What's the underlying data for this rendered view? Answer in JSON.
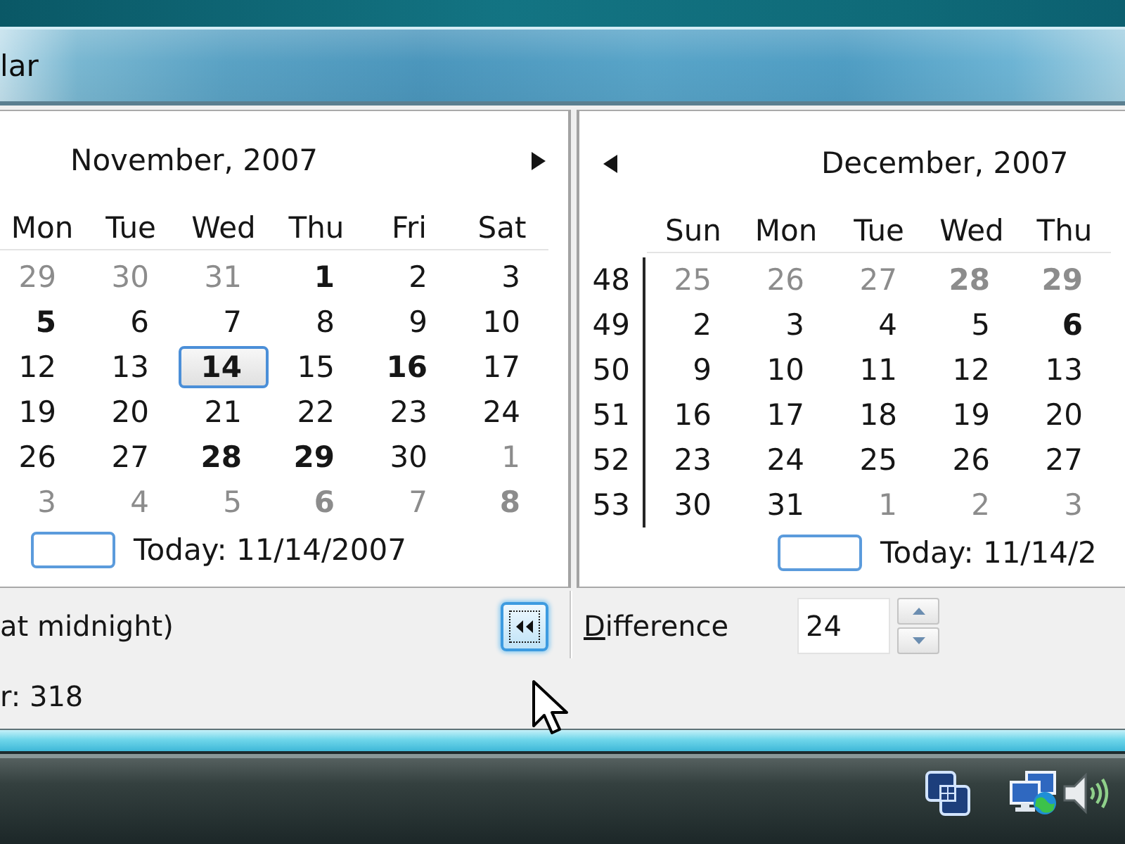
{
  "window": {
    "title": "lar"
  },
  "calendars": [
    {
      "month": "November, 2007",
      "has_prev": false,
      "has_next": true,
      "weekdays": [
        "Mon",
        "Tue",
        "Wed",
        "Thu",
        "Fri",
        "Sat"
      ],
      "weeks": [
        {
          "days": [
            {
              "day": "29",
              "other_month": true,
              "busy": false,
              "selected": false
            },
            {
              "day": "30",
              "other_month": true,
              "busy": false,
              "selected": false
            },
            {
              "day": "31",
              "other_month": true,
              "busy": false,
              "selected": false
            },
            {
              "day": "1",
              "other_month": false,
              "busy": true,
              "selected": false
            },
            {
              "day": "2",
              "other_month": false,
              "busy": false,
              "selected": false
            },
            {
              "day": "3",
              "other_month": false,
              "busy": false,
              "selected": false
            }
          ]
        },
        {
          "days": [
            {
              "day": "5",
              "other_month": false,
              "busy": true,
              "selected": false
            },
            {
              "day": "6",
              "other_month": false,
              "busy": false,
              "selected": false
            },
            {
              "day": "7",
              "other_month": false,
              "busy": false,
              "selected": false
            },
            {
              "day": "8",
              "other_month": false,
              "busy": false,
              "selected": false
            },
            {
              "day": "9",
              "other_month": false,
              "busy": false,
              "selected": false
            },
            {
              "day": "10",
              "other_month": false,
              "busy": false,
              "selected": false
            }
          ]
        },
        {
          "days": [
            {
              "day": "12",
              "other_month": false,
              "busy": false,
              "selected": false
            },
            {
              "day": "13",
              "other_month": false,
              "busy": false,
              "selected": false
            },
            {
              "day": "14",
              "other_month": false,
              "busy": true,
              "selected": true
            },
            {
              "day": "15",
              "other_month": false,
              "busy": false,
              "selected": false
            },
            {
              "day": "16",
              "other_month": false,
              "busy": true,
              "selected": false
            },
            {
              "day": "17",
              "other_month": false,
              "busy": false,
              "selected": false
            }
          ]
        },
        {
          "days": [
            {
              "day": "19",
              "other_month": false,
              "busy": false,
              "selected": false
            },
            {
              "day": "20",
              "other_month": false,
              "busy": false,
              "selected": false
            },
            {
              "day": "21",
              "other_month": false,
              "busy": false,
              "selected": false
            },
            {
              "day": "22",
              "other_month": false,
              "busy": false,
              "selected": false
            },
            {
              "day": "23",
              "other_month": false,
              "busy": false,
              "selected": false
            },
            {
              "day": "24",
              "other_month": false,
              "busy": false,
              "selected": false
            }
          ]
        },
        {
          "days": [
            {
              "day": "26",
              "other_month": false,
              "busy": false,
              "selected": false
            },
            {
              "day": "27",
              "other_month": false,
              "busy": false,
              "selected": false
            },
            {
              "day": "28",
              "other_month": false,
              "busy": true,
              "selected": false
            },
            {
              "day": "29",
              "other_month": false,
              "busy": true,
              "selected": false
            },
            {
              "day": "30",
              "other_month": false,
              "busy": false,
              "selected": false
            },
            {
              "day": "1",
              "other_month": true,
              "busy": false,
              "selected": false
            }
          ]
        },
        {
          "days": [
            {
              "day": "3",
              "other_month": true,
              "busy": false,
              "selected": false
            },
            {
              "day": "4",
              "other_month": true,
              "busy": false,
              "selected": false
            },
            {
              "day": "5",
              "other_month": true,
              "busy": false,
              "selected": false
            },
            {
              "day": "6",
              "other_month": true,
              "busy": true,
              "selected": false
            },
            {
              "day": "7",
              "other_month": true,
              "busy": false,
              "selected": false
            },
            {
              "day": "8",
              "other_month": true,
              "busy": true,
              "selected": false
            }
          ]
        }
      ],
      "today": "Today: 11/14/2007"
    },
    {
      "month": "December, 2007",
      "has_prev": true,
      "has_next": false,
      "weekdays": [
        "Sun",
        "Mon",
        "Tue",
        "Wed",
        "Thu"
      ],
      "weeks": [
        {
          "week_number": "48",
          "days": [
            {
              "day": "25",
              "other_month": true,
              "busy": false,
              "selected": false
            },
            {
              "day": "26",
              "other_month": true,
              "busy": false,
              "selected": false
            },
            {
              "day": "27",
              "other_month": true,
              "busy": false,
              "selected": false
            },
            {
              "day": "28",
              "other_month": true,
              "busy": true,
              "selected": false
            },
            {
              "day": "29",
              "other_month": true,
              "busy": true,
              "selected": false
            }
          ]
        },
        {
          "week_number": "49",
          "days": [
            {
              "day": "2",
              "other_month": false,
              "busy": false,
              "selected": false
            },
            {
              "day": "3",
              "other_month": false,
              "busy": false,
              "selected": false
            },
            {
              "day": "4",
              "other_month": false,
              "busy": false,
              "selected": false
            },
            {
              "day": "5",
              "other_month": false,
              "busy": false,
              "selected": false
            },
            {
              "day": "6",
              "other_month": false,
              "busy": true,
              "selected": false
            }
          ]
        },
        {
          "week_number": "50",
          "days": [
            {
              "day": "9",
              "other_month": false,
              "busy": false,
              "selected": false
            },
            {
              "day": "10",
              "other_month": false,
              "busy": false,
              "selected": false
            },
            {
              "day": "11",
              "other_month": false,
              "busy": false,
              "selected": false
            },
            {
              "day": "12",
              "other_month": false,
              "busy": false,
              "selected": false
            },
            {
              "day": "13",
              "other_month": false,
              "busy": false,
              "selected": false
            }
          ]
        },
        {
          "week_number": "51",
          "days": [
            {
              "day": "16",
              "other_month": false,
              "busy": false,
              "selected": false
            },
            {
              "day": "17",
              "other_month": false,
              "busy": false,
              "selected": false
            },
            {
              "day": "18",
              "other_month": false,
              "busy": false,
              "selected": false
            },
            {
              "day": "19",
              "other_month": false,
              "busy": false,
              "selected": false
            },
            {
              "day": "20",
              "other_month": false,
              "busy": false,
              "selected": false
            }
          ]
        },
        {
          "week_number": "52",
          "days": [
            {
              "day": "23",
              "other_month": false,
              "busy": false,
              "selected": false
            },
            {
              "day": "24",
              "other_month": false,
              "busy": false,
              "selected": false
            },
            {
              "day": "25",
              "other_month": false,
              "busy": false,
              "selected": false
            },
            {
              "day": "26",
              "other_month": false,
              "busy": false,
              "selected": false
            },
            {
              "day": "27",
              "other_month": false,
              "busy": false,
              "selected": false
            }
          ]
        },
        {
          "week_number": "53",
          "days": [
            {
              "day": "30",
              "other_month": false,
              "busy": false,
              "selected": false
            },
            {
              "day": "31",
              "other_month": false,
              "busy": false,
              "selected": false
            },
            {
              "day": "1",
              "other_month": true,
              "busy": false,
              "selected": false
            },
            {
              "day": "2",
              "other_month": true,
              "busy": false,
              "selected": false
            },
            {
              "day": "3",
              "other_month": true,
              "busy": false,
              "selected": false
            }
          ]
        }
      ],
      "today": "Today: 11/14/2"
    }
  ],
  "note": "at midnight)",
  "back_button": {
    "focused": true
  },
  "difference": {
    "label": "Difference",
    "access_key_underlined": true,
    "value": "24"
  },
  "status_text": "r: 318"
}
